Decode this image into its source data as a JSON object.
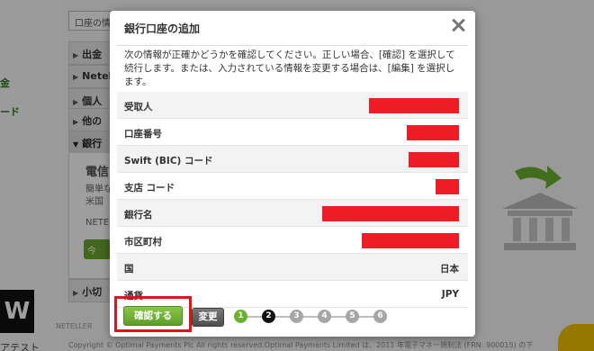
{
  "background": {
    "search_text": "口座の情",
    "left_labels": [
      "金",
      "ード"
    ],
    "accordion": [
      "出金",
      "Neteller",
      "個人",
      "他の",
      "銀行",
      "小切"
    ],
    "open_panel": {
      "heading": "電信",
      "line1": "簡単な",
      "line2": "米国",
      "line3": "NETE",
      "button": "今"
    },
    "bottom_left": "アテスト",
    "footer_left": "NETELLER",
    "footer": "Copyright © Optimal Payments Plc All rights reserved.Optimal Payments Limited は、2011 年電子マネー規制法 (FRN: 900015) の下"
  },
  "modal": {
    "title": "銀行口座の追加",
    "description": "次の情報が正確かどうかを確認してください。正しい場合、[確認] を選択して続行します。または、入力されている情報を変更する場合は、[編集] を選択します。",
    "rows": [
      {
        "label": "受取人",
        "value": "",
        "redacted": true
      },
      {
        "label": "口座番号",
        "value": "",
        "redacted": true
      },
      {
        "label": "Swift (BIC) コード",
        "value": "",
        "redacted": true
      },
      {
        "label": "支店 コード",
        "value": "",
        "redacted": true
      },
      {
        "label": "銀行名",
        "value": "",
        "redacted": true
      },
      {
        "label": "市区町村",
        "value": "",
        "redacted": true
      },
      {
        "label": "国",
        "value": "日本",
        "redacted": false
      },
      {
        "label": "通貨",
        "value": "JPY",
        "redacted": false
      }
    ],
    "confirm_label": "確認する",
    "edit_label": "変更",
    "steps": [
      "1",
      "2",
      "3",
      "4",
      "5",
      "6"
    ],
    "current_step": 2
  },
  "colors": {
    "accent_green": "#6bb12f",
    "highlight_red": "#e0131b",
    "redaction": "#ee1c25"
  }
}
